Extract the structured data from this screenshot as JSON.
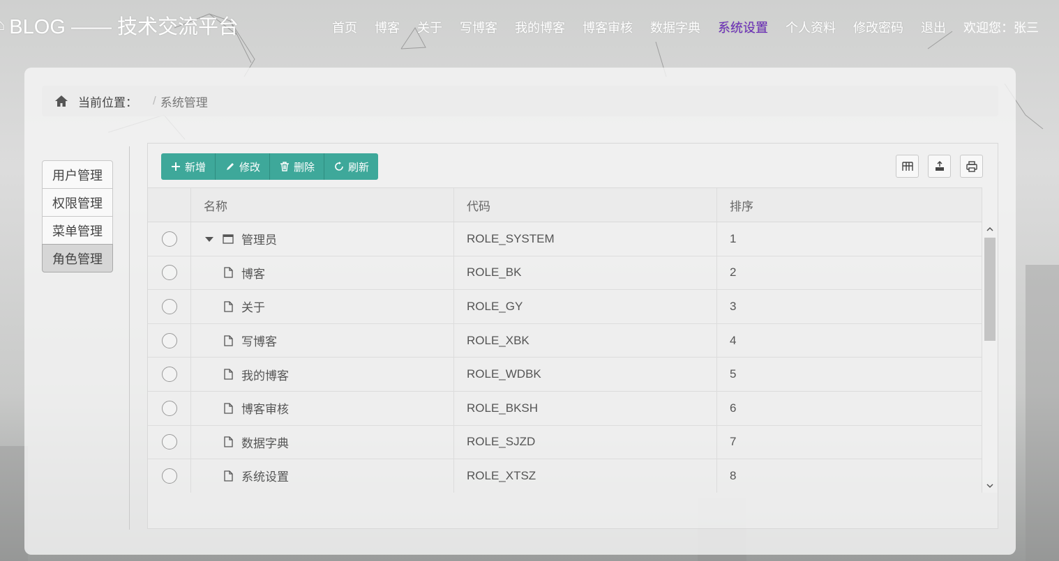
{
  "header": {
    "logo_text": "BLOG —— 技术交流平台",
    "nav": [
      {
        "label": "首页",
        "active": false
      },
      {
        "label": "博客",
        "active": false
      },
      {
        "label": "关于",
        "active": false
      },
      {
        "label": "写博客",
        "active": false
      },
      {
        "label": "我的博客",
        "active": false
      },
      {
        "label": "博客审核",
        "active": false
      },
      {
        "label": "数据字典",
        "active": false
      },
      {
        "label": "系统设置",
        "active": true
      },
      {
        "label": "个人资料",
        "active": false
      },
      {
        "label": "修改密码",
        "active": false
      },
      {
        "label": "退出",
        "active": false
      }
    ],
    "welcome": "欢迎您：张三"
  },
  "breadcrumb": {
    "label": "当前位置：",
    "separator": "/",
    "current": "系统管理"
  },
  "side_menu": [
    {
      "label": "用户管理",
      "active": false
    },
    {
      "label": "权限管理",
      "active": false
    },
    {
      "label": "菜单管理",
      "active": false
    },
    {
      "label": "角色管理",
      "active": true
    }
  ],
  "toolbar": {
    "add": "新增",
    "edit": "修改",
    "delete": "删除",
    "refresh": "刷新"
  },
  "tools": [
    "columns-icon",
    "export-icon",
    "print-icon"
  ],
  "table": {
    "columns": [
      "名称",
      "代码",
      "排序"
    ],
    "rows": [
      {
        "name": "管理员",
        "code": "ROLE_SYSTEM",
        "order": "1",
        "level": 0,
        "folder": true,
        "expanded": true
      },
      {
        "name": "博客",
        "code": "ROLE_BK",
        "order": "2",
        "level": 1,
        "folder": false
      },
      {
        "name": "关于",
        "code": "ROLE_GY",
        "order": "3",
        "level": 1,
        "folder": false
      },
      {
        "name": "写博客",
        "code": "ROLE_XBK",
        "order": "4",
        "level": 1,
        "folder": false
      },
      {
        "name": "我的博客",
        "code": "ROLE_WDBK",
        "order": "5",
        "level": 1,
        "folder": false
      },
      {
        "name": "博客审核",
        "code": "ROLE_BKSH",
        "order": "6",
        "level": 1,
        "folder": false
      },
      {
        "name": "数据字典",
        "code": "ROLE_SJZD",
        "order": "7",
        "level": 1,
        "folder": false
      },
      {
        "name": "系统设置",
        "code": "ROLE_XTSZ",
        "order": "8",
        "level": 1,
        "folder": false
      }
    ]
  },
  "colors": {
    "accent": "#3ea89a",
    "nav_active": "#6a2bb8"
  }
}
